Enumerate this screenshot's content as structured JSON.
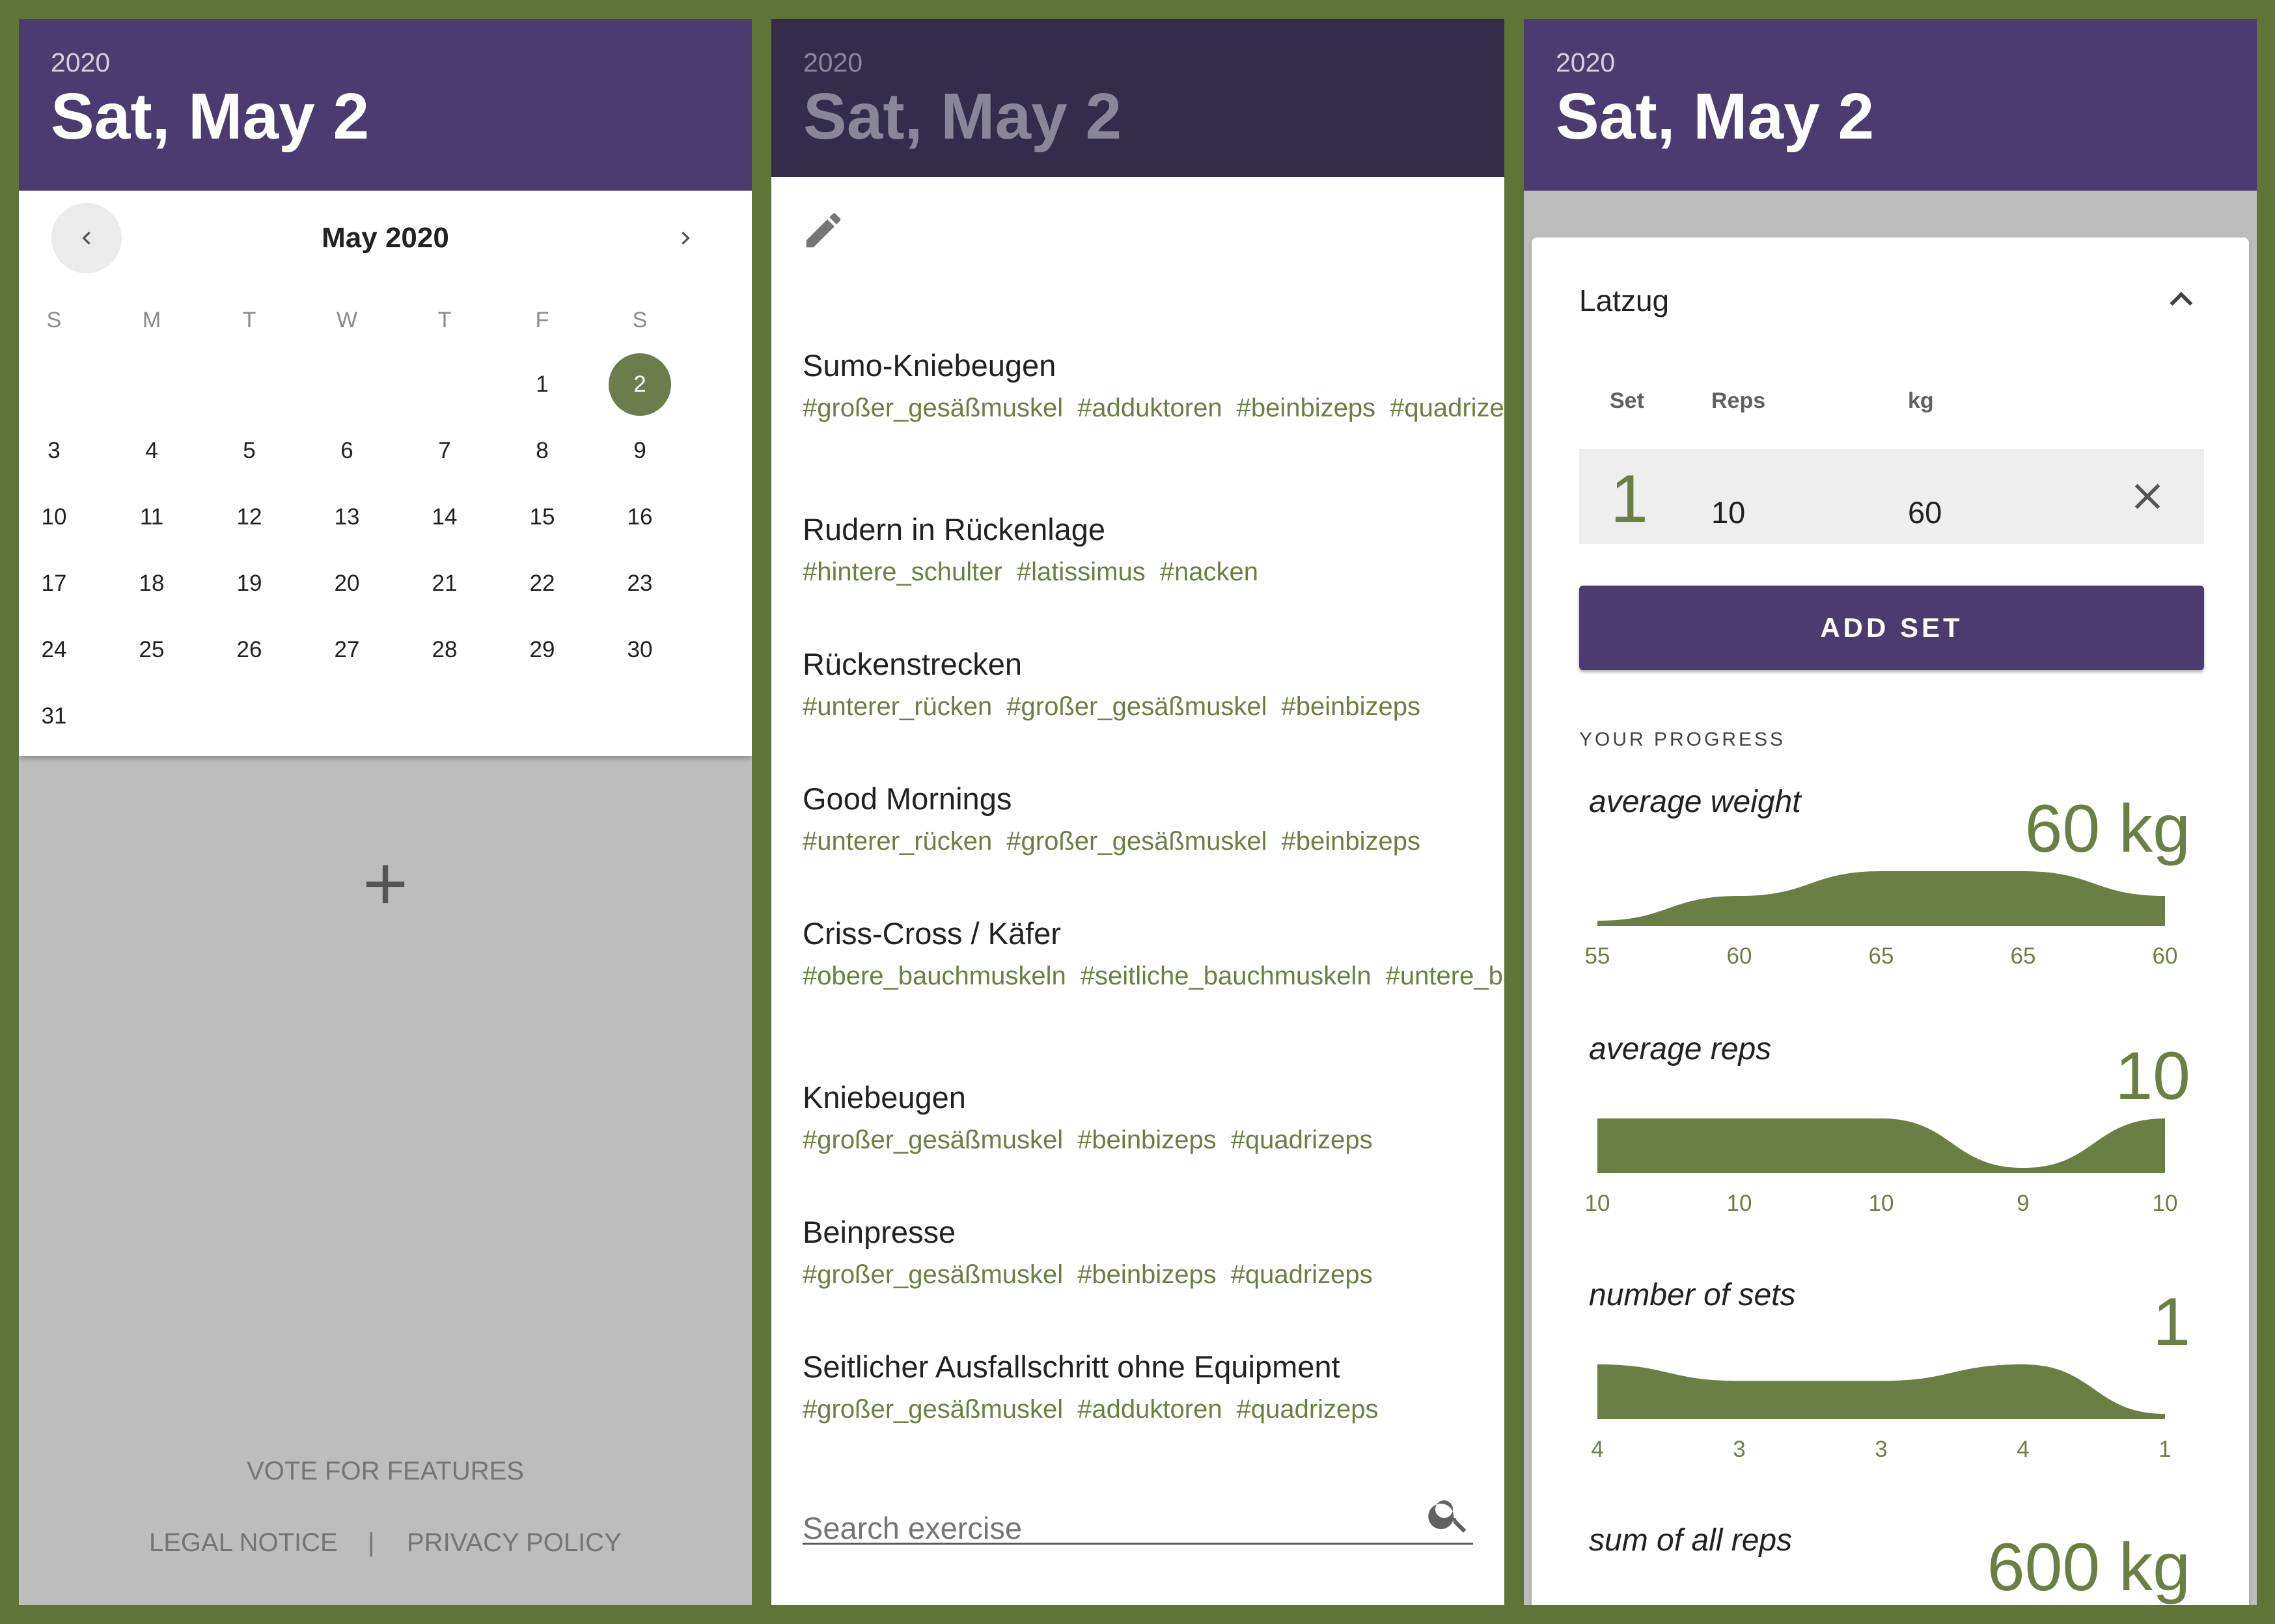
{
  "calendar_screen": {
    "header": {
      "year": "2020",
      "date": "Sat, May 2"
    },
    "month_title": "May 2020",
    "weekdays": [
      "S",
      "M",
      "T",
      "W",
      "T",
      "F",
      "S"
    ],
    "first_weekday_index": 5,
    "days": [
      "1",
      "2",
      "3",
      "4",
      "5",
      "6",
      "7",
      "8",
      "9",
      "10",
      "11",
      "12",
      "13",
      "14",
      "15",
      "16",
      "17",
      "18",
      "19",
      "20",
      "21",
      "22",
      "23",
      "24",
      "25",
      "26",
      "27",
      "28",
      "29",
      "30",
      "31"
    ],
    "selected_day": "2",
    "icons": {
      "prev": "chevron-left-icon",
      "next": "chevron-right-icon",
      "add": "plus-icon"
    },
    "footer": {
      "vote": "VOTE FOR FEATURES",
      "legal": "LEGAL NOTICE",
      "separator": "|",
      "privacy": "PRIVACY POLICY"
    }
  },
  "exercise_screen": {
    "header": {
      "year": "2020",
      "date": "Sat, May 2"
    },
    "edit_icon": "pencil-icon",
    "exercises": [
      {
        "name": "Sumo-Kniebeugen",
        "tags": [
          "#großer_gesäßmuskel",
          "#adduktoren",
          "#beinbizeps",
          "#quadrizeps"
        ]
      },
      {
        "name": "Rudern in Rückenlage",
        "tags": [
          "#hintere_schulter",
          "#latissimus",
          "#nacken"
        ]
      },
      {
        "name": "Rückenstrecken",
        "tags": [
          "#unterer_rücken",
          "#großer_gesäßmuskel",
          "#beinbizeps"
        ]
      },
      {
        "name": "Good Mornings",
        "tags": [
          "#unterer_rücken",
          "#großer_gesäßmuskel",
          "#beinbizeps"
        ]
      },
      {
        "name": "Criss-Cross / Käfer",
        "tags": [
          "#obere_bauchmuskeln",
          "#seitliche_bauchmuskeln",
          "#untere_bauchmuskeln"
        ]
      },
      {
        "name": "Kniebeugen",
        "tags": [
          "#großer_gesäßmuskel",
          "#beinbizeps",
          "#quadrizeps"
        ]
      },
      {
        "name": "Beinpresse",
        "tags": [
          "#großer_gesäßmuskel",
          "#beinbizeps",
          "#quadrizeps"
        ]
      },
      {
        "name": "Seitlicher Ausfallschritt ohne Equipment",
        "tags": [
          "#großer_gesäßmuskel",
          "#adduktoren",
          "#quadrizeps"
        ]
      }
    ],
    "search": {
      "placeholder": "Search exercise",
      "icon": "search-icon"
    }
  },
  "workout_screen": {
    "header": {
      "year": "2020",
      "date": "Sat, May 2"
    },
    "exercise_title": "Latzug",
    "collapse_icon": "chevron-up-icon",
    "columns": {
      "set": "Set",
      "reps": "Reps",
      "kg": "kg"
    },
    "sets": [
      {
        "set": "1",
        "reps": "10",
        "kg": "60"
      }
    ],
    "delete_icon": "close-icon",
    "add_set_label": "ADD SET",
    "progress_title": "YOUR PROGRESS",
    "colors": {
      "accent": "#6b7f44",
      "primary": "#4b3b70"
    }
  },
  "chart_data": [
    {
      "type": "area",
      "title": "average weight",
      "headline": "60 kg",
      "x_labels": [
        "55",
        "60",
        "65",
        "65",
        "60"
      ],
      "values": [
        55,
        60,
        65,
        65,
        60
      ]
    },
    {
      "type": "area",
      "title": "average reps",
      "headline": "10",
      "x_labels": [
        "10",
        "10",
        "10",
        "9",
        "10"
      ],
      "values": [
        10,
        10,
        10,
        9,
        10
      ]
    },
    {
      "type": "area",
      "title": "number of sets",
      "headline": "1",
      "x_labels": [
        "4",
        "3",
        "3",
        "4",
        "1"
      ],
      "values": [
        4,
        3,
        3,
        4,
        1
      ]
    },
    {
      "type": "area",
      "title": "sum of all reps",
      "headline": "600 kg"
    }
  ]
}
